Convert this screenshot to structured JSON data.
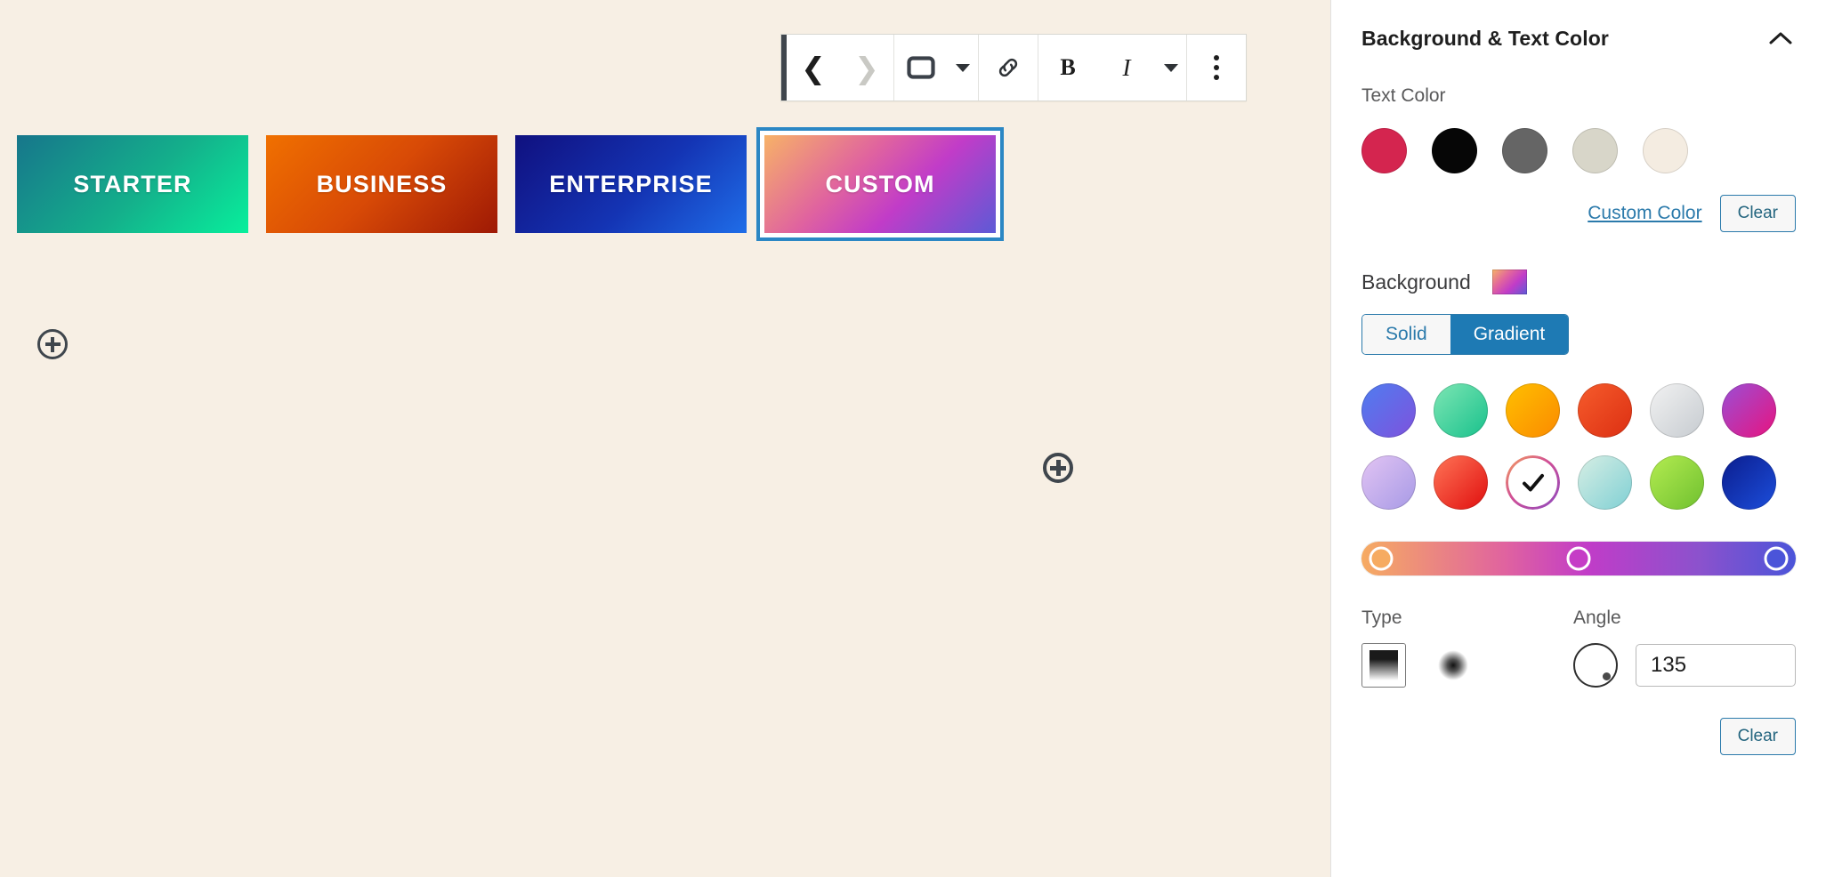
{
  "canvas": {
    "background_color": "#f7efe4",
    "toolbar": {
      "back_icon": "chevron-left-icon",
      "forward_icon": "chevron-right-icon",
      "block_type_icon": "button-block-icon",
      "block_type_caret_icon": "chevron-down-icon",
      "link_icon": "link-icon",
      "bold_label": "B",
      "italic_label": "I",
      "more_formats_icon": "chevron-down-icon",
      "options_icon": "three-dots-vertical-icon"
    },
    "inserter_icon": "circle-plus-icon",
    "buttons": [
      {
        "label": "STARTER",
        "gradient": "linear-gradient(135deg, #17768b 0%, #14b08b 55%, #08ef9c 100%)",
        "selected": false
      },
      {
        "label": "BUSINESS",
        "gradient": "linear-gradient(135deg, #f07000 0%, #d84a06 50%, #9e1905 100%)",
        "selected": false
      },
      {
        "label": "ENTERPRISE",
        "gradient": "linear-gradient(135deg, #10107f 0%, #1434b4 55%, #1f6de8 100%)",
        "selected": false
      },
      {
        "label": "CUSTOM",
        "gradient": "linear-gradient(135deg, #f7b267 0%, #e0639f 38%, #c13cc8 62%, #5d5ad6 100%)",
        "selected": true
      }
    ]
  },
  "sidebar": {
    "panel": {
      "title": "Background & Text Color",
      "collapse_icon": "chevron-up-icon"
    },
    "text_color": {
      "label": "Text Color",
      "swatches": [
        {
          "name": "crimson",
          "color": "#d4254f"
        },
        {
          "name": "black",
          "color": "#060606"
        },
        {
          "name": "dark-gray",
          "color": "#656565"
        },
        {
          "name": "light-gray",
          "color": "#d8d6c9"
        },
        {
          "name": "off-white",
          "color": "#f4ece1"
        }
      ],
      "custom_color_link": "Custom Color",
      "clear_label": "Clear"
    },
    "background": {
      "label": "Background",
      "preview_gradient": "linear-gradient(135deg, #f7b267 0%, #e0639f 35%, #c13cc8 62%, #5d5ad6 100%)",
      "tabs": [
        {
          "label": "Solid",
          "active": false
        },
        {
          "label": "Gradient",
          "active": true
        }
      ],
      "active_tab_color": "#1e7ab4",
      "presets": [
        {
          "name": "blue-purple",
          "gradient": "linear-gradient(135deg, #4f7df0 0%, #7e52dd 100%)",
          "selected": false
        },
        {
          "name": "mint-green",
          "gradient": "linear-gradient(135deg, #7ee6b4 0%, #18c18c 100%)",
          "selected": false
        },
        {
          "name": "amber-orange",
          "gradient": "linear-gradient(135deg, #ffc000 0%, #fb8a00 100%)",
          "selected": false
        },
        {
          "name": "red-orange",
          "gradient": "linear-gradient(135deg, #f65c2c 0%, #dc2f12 100%)",
          "selected": false
        },
        {
          "name": "silver-gray",
          "gradient": "linear-gradient(135deg, #f2f2f2 0%, #c6cbd0 100%)",
          "selected": false
        },
        {
          "name": "purple-magenta",
          "gradient": "linear-gradient(135deg, #9a4fd6 0%, #e8137f 100%)",
          "selected": false
        },
        {
          "name": "lavender",
          "gradient": "linear-gradient(135deg, #e2c4f3 0%, #a79ae6 100%)",
          "selected": false
        },
        {
          "name": "red-scarlet",
          "gradient": "linear-gradient(135deg, #ff7557 0%, #e00e0e 100%)",
          "selected": false
        },
        {
          "name": "orange-magenta-purple",
          "gradient": "linear-gradient(135deg, #f5a25b 0%, #d04e96 45%, #8b4ac0 100%)",
          "selected": true
        },
        {
          "name": "pale-teal",
          "gradient": "linear-gradient(135deg, #d7eee4 0%, #7fd0d4 100%)",
          "selected": false
        },
        {
          "name": "lime-green",
          "gradient": "linear-gradient(135deg, #b4ec51 0%, #6fc02f 100%)",
          "selected": false
        },
        {
          "name": "deep-blue",
          "gradient": "linear-gradient(135deg, #0b1d8e 0%, #1c4edb 100%)",
          "selected": false
        }
      ],
      "selected_check_icon": "checkmark-icon",
      "slider": {
        "gradient": "linear-gradient(90deg, #f6ab62 0%, #e0639f 33%, #c13cc8 52%, #8b52cd 78%, #4b54d9 100%)",
        "stops": [
          {
            "position_percent": 0,
            "color": "#f6ab62"
          },
          {
            "position_percent": 50,
            "color": "#c53cc6"
          },
          {
            "position_percent": 100,
            "color": "#4b54d9"
          }
        ]
      }
    },
    "type": {
      "label": "Type",
      "options": [
        {
          "name": "linear",
          "selected": true
        },
        {
          "name": "radial",
          "selected": false
        }
      ]
    },
    "angle": {
      "label": "Angle",
      "value": "135",
      "dial_icon": "angle-dial-icon"
    },
    "footer_clear_label": "Clear"
  }
}
